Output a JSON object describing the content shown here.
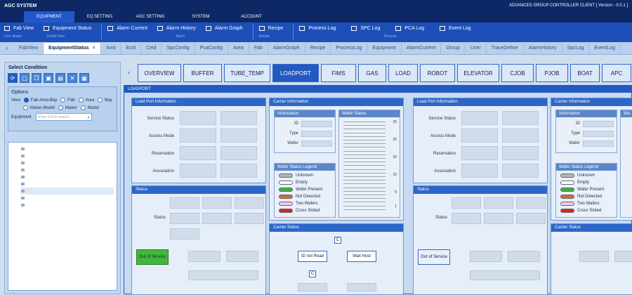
{
  "app": {
    "title": "AGC SYSTEM",
    "version": "ADVANCED GROUP CONTROLLER CLIENT [ Version - 0.0.1 ]"
  },
  "menu": [
    "EQUIPMENT",
    "EQ SETTING",
    "AGC SETTING",
    "SYSTEM",
    "ACCOUNT"
  ],
  "subnav": {
    "groups": [
      {
        "items": [
          "Fab View",
          "Equipment Status"
        ],
        "caps": [
          "Line Stauts",
          "Detail View"
        ]
      },
      {
        "items": [
          "Alarm Current",
          "Alarm History",
          "Alarm Graph"
        ],
        "cap": "Alarm"
      },
      {
        "items": [
          "Recipe"
        ],
        "cap": "Recipe"
      },
      {
        "items": [
          "Process Log",
          "SPC Log",
          "PCA Log",
          "Event Log"
        ],
        "cap": "Process"
      }
    ]
  },
  "tabs": [
    "FabView",
    "EquipmentStatus",
    "Svid",
    "Ecid",
    "Ceid",
    "SpcConfig",
    "PcaConfig",
    "Area",
    "Fab",
    "AlarmGraph",
    "Recipe",
    "ProcessLog",
    "Equipment",
    "AlarmCurrent",
    "Group",
    "User",
    "TraceDefine",
    "AlarmHistory",
    "SpcLog",
    "EventLog"
  ],
  "left": {
    "title": "Select Condition",
    "options_title": "Options",
    "view_label": "View",
    "views": [
      "Fab-Area-Bay",
      "Fab",
      "Area",
      "Bay",
      "Maker-Model",
      "Maker",
      "Model"
    ],
    "equipment_label": "Equipment",
    "equipment_placeholder": "Enter text to search...",
    "list": [
      "",
      "",
      "",
      "",
      "",
      "",
      "",
      "",
      ""
    ]
  },
  "nav_tabs": [
    "OVERVIEW",
    "BUFFER",
    "TUBE_TEMP",
    "LOADPORT",
    "FIMS",
    "GAS",
    "LOAD",
    "ROBOT",
    "ELEVATOR",
    "CJOB",
    "PJOB",
    "BOAT",
    "APC"
  ],
  "panel": {
    "title": "LOADPORT",
    "lp_info": "Load Port Information",
    "carrier_info": "Carrier Information",
    "status": "Status",
    "carrier_status": "Carrier Status",
    "lp_labels": [
      "Service Status",
      "Access Mode",
      "Reservation",
      "Association"
    ],
    "info": {
      "title": "Information",
      "labels": [
        "ID",
        "Type",
        "Wafer"
      ]
    },
    "wafer_status": "Wafer Status",
    "wafer_ticks": [
      "25",
      "20",
      "15",
      "10",
      "5",
      "1"
    ],
    "legend": {
      "title": "Wafer Status Legend",
      "items": [
        {
          "label": "Unknown",
          "color": "#b5b5b5"
        },
        {
          "label": "Empty",
          "color": "#ffffff"
        },
        {
          "label": "Wafer Present",
          "color": "#3cb043"
        },
        {
          "label": "Not Detected",
          "color": "#e2652d"
        },
        {
          "label": "Two Wafers",
          "color": "#f3c6ef"
        },
        {
          "label": "Cross Sloted",
          "color": "#e22020"
        }
      ]
    },
    "status_label": "Status",
    "out_of_service": "Out of Service",
    "flow": {
      "c": "C",
      "id_not_read": "ID not Read",
      "wait_host": "Wait Host",
      "c2": "C"
    }
  }
}
